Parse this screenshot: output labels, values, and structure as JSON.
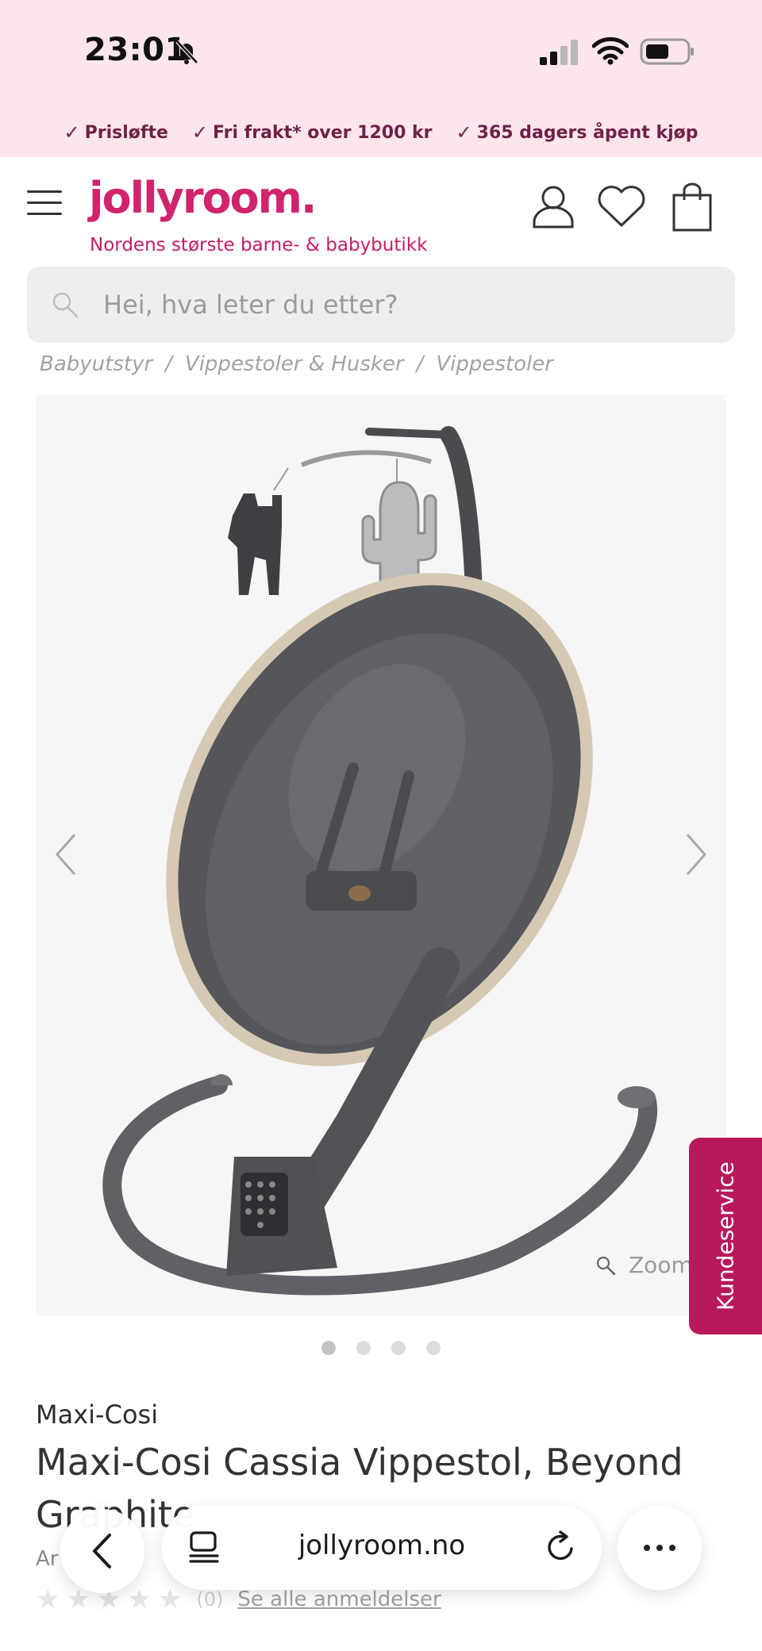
{
  "status_bar": {
    "time": "23:01"
  },
  "promo": [
    {
      "label": "Prisløfte"
    },
    {
      "label": "Fri frakt* over 1200 kr"
    },
    {
      "label": "365 dagers åpent kjøp"
    }
  ],
  "header": {
    "logo": "jollyroom.",
    "tagline": "Nordens største barne- & babybutikk"
  },
  "search": {
    "placeholder": "Hei, hva leter du etter?"
  },
  "breadcrumb": [
    "Babyutstyr",
    "Vippestoler & Husker",
    "Vippestoler"
  ],
  "gallery": {
    "zoom_label": "Zoom",
    "image_count": 4,
    "active_index": 0
  },
  "customer_service": "Kundeservice",
  "product": {
    "brand": "Maxi-Cosi",
    "title": "Maxi-Cosi Cassia Vippestol, Beyond Graphite",
    "article_partial": "Ar",
    "rating_count": "(0)",
    "reviews_link": "Se alle anmeldelser"
  },
  "browser": {
    "url": "jollyroom.no"
  },
  "colors": {
    "brand": "#d0246d",
    "promo": "#6f2148",
    "service": "#b8195c"
  }
}
